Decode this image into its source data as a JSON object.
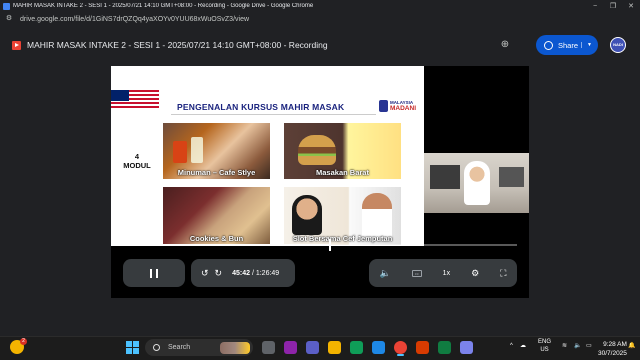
{
  "browser": {
    "window_title": "MAHIR MASAK INTAKE 2 - SESI 1 - 2025/07/21 14:10 GMT+08:00 - Recording - Google Drive - Google Chrome",
    "url": "drive.google.com/file/d/1GiNS7drQZQq4yaXOYv0YUU68xWuOSvZ3/view",
    "controls": {
      "minimize": "−",
      "restore": "❐",
      "close": "✕"
    }
  },
  "drive": {
    "file_title": "MAHIR MASAK INTAKE 2 - SESI 1 - 2025/07/21 14:10 GMT+08:00 - Recording",
    "share_label": "Share",
    "avatar_text": "NADI",
    "colors": {
      "share": "#0b57d0",
      "file_icon": "#ea4335"
    }
  },
  "slide": {
    "title": "PENGENALAN KURSUS MAHIR MASAK",
    "logo_line1": "MALAYSIA",
    "logo_line2": "MADANI",
    "modul_number": "4",
    "modul_label": "MODUL",
    "tiles": [
      {
        "label": "Minuman – Cafe Stlye"
      },
      {
        "label": "Masakan Barat"
      },
      {
        "label": "Cookies & Bun"
      },
      {
        "label": "Slot Bersama Cef Jemputan"
      }
    ]
  },
  "player": {
    "current_time": "45:42",
    "duration": "/ 1:26:49",
    "speed": "1x",
    "progress_fraction": 0.526,
    "icons": [
      "pause-icon",
      "rewind-10-icon",
      "forward-10-icon",
      "volume-icon",
      "captions-icon",
      "settings-icon",
      "fullscreen-icon"
    ]
  },
  "taskbar": {
    "search_placeholder": "Search",
    "weather_badge": "2",
    "language": "ENG",
    "region": "US",
    "time": "9:28 AM",
    "date": "30/7/2025"
  }
}
